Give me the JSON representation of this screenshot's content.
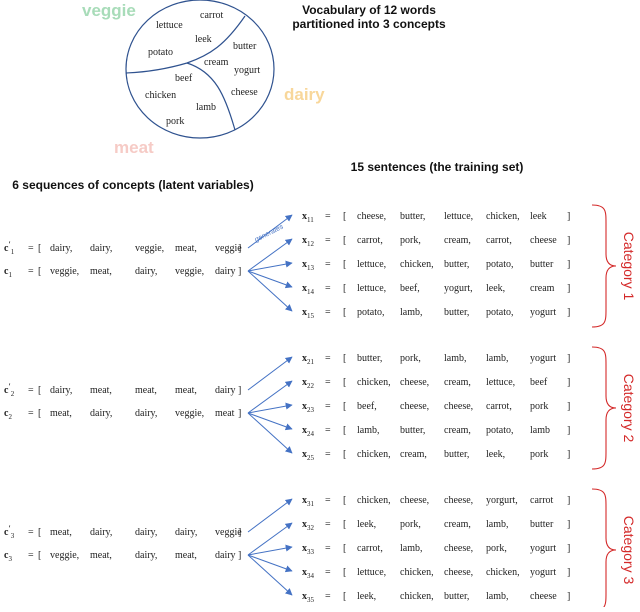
{
  "header": {
    "vocab_title_line1": "Vocabulary of 12 words",
    "vocab_title_line2": "partitioned into 3 concepts",
    "sequences_title": "6 sequences of concepts (latent variables)",
    "sentences_title": "15 sentences (the training set)"
  },
  "concepts": {
    "veggie": {
      "label": "veggie",
      "color": "#a8dcb9"
    },
    "dairy": {
      "label": "dairy",
      "color": "#f8d79b"
    },
    "meat": {
      "label": "meat",
      "color": "#f6cbc6"
    }
  },
  "vocabulary": {
    "veggie": [
      "lettuce",
      "carrot",
      "leek",
      "potato"
    ],
    "dairy": [
      "butter",
      "cream",
      "yogurt",
      "cheese"
    ],
    "meat": [
      "beef",
      "chicken",
      "lamb",
      "pork"
    ]
  },
  "arrow_label": "generates",
  "equals": "=",
  "groups": [
    {
      "category": "Category 1",
      "latent": [
        {
          "name": "c",
          "index": "1",
          "prime": true,
          "values": [
            "dairy,",
            "dairy,",
            "veggie,",
            "meat,",
            "veggie"
          ]
        },
        {
          "name": "c",
          "index": "1",
          "prime": false,
          "values": [
            "veggie,",
            "meat,",
            "dairy,",
            "veggie,",
            "dairy"
          ]
        }
      ],
      "sentences": [
        {
          "name": "x",
          "index": "11",
          "words": [
            "cheese,",
            "butter,",
            "lettuce,",
            "chicken,",
            "leek"
          ]
        },
        {
          "name": "x",
          "index": "12",
          "words": [
            "carrot,",
            "pork,",
            "cream,",
            "carrot,",
            "cheese"
          ]
        },
        {
          "name": "x",
          "index": "13",
          "words": [
            "lettuce,",
            "chicken,",
            "butter,",
            "potato,",
            "butter"
          ]
        },
        {
          "name": "x",
          "index": "14",
          "words": [
            "lettuce,",
            "beef,",
            "yogurt,",
            "leek,",
            "cream"
          ]
        },
        {
          "name": "x",
          "index": "15",
          "words": [
            "potato,",
            "lamb,",
            "butter,",
            "potato,",
            "yogurt"
          ]
        }
      ]
    },
    {
      "category": "Category 2",
      "latent": [
        {
          "name": "c",
          "index": "2",
          "prime": true,
          "values": [
            "dairy,",
            "meat,",
            "meat,",
            "meat,",
            "dairy"
          ]
        },
        {
          "name": "c",
          "index": "2",
          "prime": false,
          "values": [
            "meat,",
            "dairy,",
            "dairy,",
            "veggie,",
            "meat"
          ]
        }
      ],
      "sentences": [
        {
          "name": "x",
          "index": "21",
          "words": [
            "butter,",
            "pork,",
            "lamb,",
            "lamb,",
            "yogurt"
          ]
        },
        {
          "name": "x",
          "index": "22",
          "words": [
            "chicken,",
            "cheese,",
            "cream,",
            "lettuce,",
            "beef"
          ]
        },
        {
          "name": "x",
          "index": "23",
          "words": [
            "beef,",
            "cheese,",
            "cheese,",
            "carrot,",
            "pork"
          ]
        },
        {
          "name": "x",
          "index": "24",
          "words": [
            "lamb,",
            "butter,",
            "cream,",
            "potato,",
            "lamb"
          ]
        },
        {
          "name": "x",
          "index": "25",
          "words": [
            "chicken,",
            "cream,",
            "butter,",
            "leek,",
            "pork"
          ]
        }
      ]
    },
    {
      "category": "Category 3",
      "latent": [
        {
          "name": "c",
          "index": "3",
          "prime": true,
          "values": [
            "meat,",
            "dairy,",
            "dairy,",
            "dairy,",
            "veggie"
          ]
        },
        {
          "name": "c",
          "index": "3",
          "prime": false,
          "values": [
            "veggie,",
            "meat,",
            "dairy,",
            "meat,",
            "dairy"
          ]
        }
      ],
      "sentences": [
        {
          "name": "x",
          "index": "31",
          "words": [
            "chicken,",
            "cheese,",
            "cheese,",
            "yorgurt,",
            "carrot"
          ]
        },
        {
          "name": "x",
          "index": "32",
          "words": [
            "leek,",
            "pork,",
            "cream,",
            "lamb,",
            "butter"
          ]
        },
        {
          "name": "x",
          "index": "33",
          "words": [
            "carrot,",
            "lamb,",
            "cheese,",
            "pork,",
            "yogurt"
          ]
        },
        {
          "name": "x",
          "index": "34",
          "words": [
            "lettuce,",
            "chicken,",
            "cheese,",
            "chicken,",
            "yogurt"
          ]
        },
        {
          "name": "x",
          "index": "35",
          "words": [
            "leek,",
            "chicken,",
            "butter,",
            "lamb,",
            "cheese"
          ]
        }
      ]
    }
  ],
  "colors": {
    "arrow": "#4472c4",
    "circle": "#2f528f",
    "category": "#d42a2a"
  }
}
